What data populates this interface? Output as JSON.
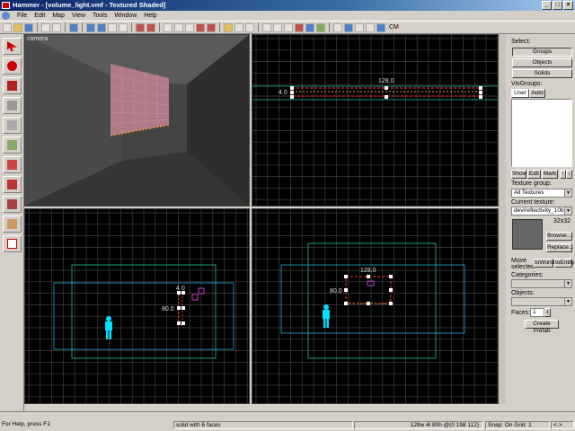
{
  "window": {
    "title": "Hammer - [volume_light.vmf - Textured Shaded]"
  },
  "menu": [
    "File",
    "Edit",
    "Map",
    "View",
    "Tools",
    "Window",
    "Help"
  ],
  "toolbar": {
    "cm_label": "CM"
  },
  "views": {
    "camera": {
      "label": "camera"
    },
    "top": {
      "width_label": "128.0",
      "height_label": "4.0"
    },
    "side": {
      "top_label": "4.0",
      "height_label": "80.0"
    },
    "front": {
      "width_label": "128.0",
      "height_label": "80.0"
    }
  },
  "panel": {
    "select_label": "Select:",
    "select_buttons": [
      "Groups",
      "Objects",
      "Solids"
    ],
    "visgroups_label": "VisGroups:",
    "visgroup_tabs": [
      "User",
      "Auto"
    ],
    "vis_buttons": [
      "Show",
      "Edit",
      "Mark"
    ],
    "texture_group_label": "Texture group:",
    "texture_group_value": "All Textures",
    "current_texture_label": "Current texture:",
    "current_texture_value": "dev/reflectivity_10b",
    "texture_size": "32x32",
    "browse_label": "Browse...",
    "replace_label": "Replace...",
    "move_selected_label": "Move selected",
    "to_world_label": "toWorld",
    "to_entity_label": "toEntity",
    "categories_label": "Categories:",
    "objects_label": "Objects:",
    "faces_label": "Faces:",
    "faces_value": "1",
    "create_prefab_label": "Create Prefab"
  },
  "status": {
    "help": "For Help, press F1",
    "selection": "solid with 6 faces",
    "size": "128w 4l 80h @(0 198 112)",
    "snap": "Snap: On Grid: 1",
    "nav": "<->"
  },
  "colors": {
    "grid": "#4a4a4a",
    "selection": "#ff3030",
    "entity": "#00e0ff",
    "bounds": "#20c0a0"
  }
}
